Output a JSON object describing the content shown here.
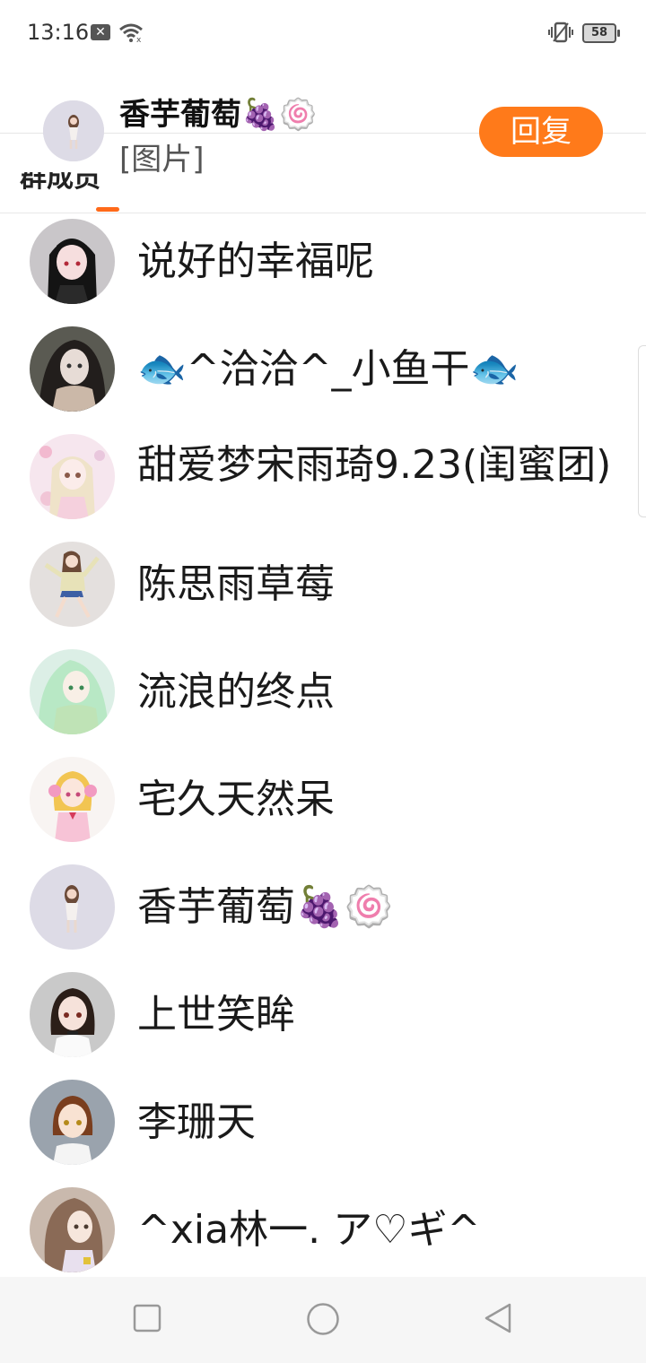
{
  "status_bar": {
    "time": "13:16",
    "battery": "58",
    "icons": [
      "notification-x-icon",
      "wifi-icon",
      "vibrate-icon",
      "battery-icon"
    ]
  },
  "background": {
    "tab_partial": "群成员"
  },
  "notification": {
    "name": "香芋葡萄🍇🍥",
    "message": "[图片]",
    "reply_label": "回复",
    "accent_color": "#ff7a1a"
  },
  "members": [
    {
      "name": "说好的幸福呢"
    },
    {
      "name": "🐟^洽洽^_小鱼干🐟"
    },
    {
      "name": "甜爱梦宋雨琦9.23(闺蜜团)"
    },
    {
      "name": "陈思雨草莓"
    },
    {
      "name": "流浪的终点"
    },
    {
      "name": "宅久天然呆"
    },
    {
      "name": "香芋葡萄🍇🍥"
    },
    {
      "name": "上世笑眸"
    },
    {
      "name": "李珊天"
    },
    {
      "name": "^xia林一. ア♡ギ^"
    }
  ],
  "nav_bar": {
    "icons": [
      "recents-square-icon",
      "home-circle-icon",
      "back-triangle-icon"
    ]
  }
}
